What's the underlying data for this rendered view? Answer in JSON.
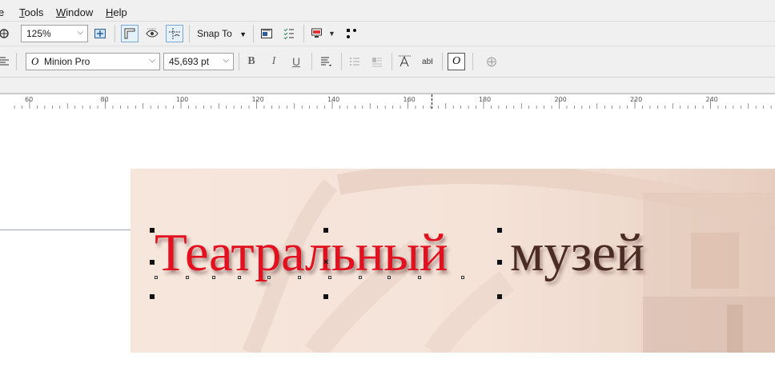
{
  "menu": {
    "items": [
      {
        "label": "e"
      },
      {
        "label": "Tools",
        "u": "T",
        "rest": "ools"
      },
      {
        "label": "Window",
        "u": "W",
        "rest": "indow"
      },
      {
        "label": "Help",
        "u": "H",
        "rest": "elp"
      }
    ]
  },
  "toolbar1": {
    "zoom_value": "125%",
    "snap_label": "Snap To"
  },
  "toolbar2": {
    "font_name": "Minion Pro",
    "font_size": "45,693 pt",
    "font_icon_glyph": "O",
    "bold_glyph": "B",
    "italic_glyph": "I",
    "underline_glyph": "U",
    "abl_glyph": "abI",
    "plus_glyph": "⊕"
  },
  "ruler": {
    "labels": [
      "60",
      "80",
      "100",
      "120",
      "140",
      "160",
      "180",
      "200",
      "220",
      "240"
    ]
  },
  "canvas": {
    "text_selected": "Театральный",
    "text_rest": "музей",
    "colors": {
      "selected": "#e3111f",
      "rest": "#4a2c25"
    }
  }
}
